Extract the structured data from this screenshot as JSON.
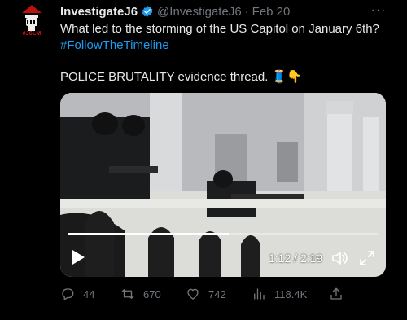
{
  "author": {
    "name": "InvestigateJ6",
    "handle": "@InvestigateJ6",
    "date": "Feb 20",
    "avatar_text": "#J6LM"
  },
  "tweet": {
    "line1": "What led to the storming of the US Capitol on January 6th?",
    "hashtag": "#FollowTheTimeline",
    "line3": "POLICE BRUTALITY evidence thread. 🧵👇"
  },
  "video": {
    "time": "1:12 / 2:19",
    "progress": 0.518
  },
  "metrics": {
    "replies": "44",
    "retweets": "670",
    "likes": "742",
    "views": "118.4K"
  },
  "colors": {
    "accent": "#1d9bf0",
    "muted": "#71767b",
    "text": "#e7e9ea"
  }
}
